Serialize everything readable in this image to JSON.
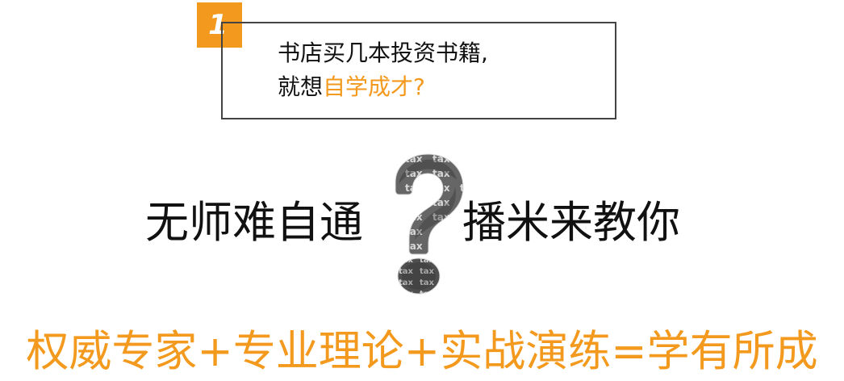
{
  "badge": {
    "number": "1"
  },
  "callout": {
    "line1": "书店买几本投资书籍,",
    "line2_prefix": "就想",
    "line2_highlight": "自学成才",
    "line2_suffix": "?"
  },
  "center": {
    "left_text": "无师难自通",
    "right_text": "播米来教你"
  },
  "slogan": {
    "text": "权威专家+专业理论+实战演练=学有所成"
  },
  "question_mark_graphic": {
    "word": "tax",
    "icon": "question-mark-icon"
  },
  "colors": {
    "accent": "#f39a1e",
    "text": "#111111",
    "border": "#444444",
    "background": "#ffffff"
  }
}
